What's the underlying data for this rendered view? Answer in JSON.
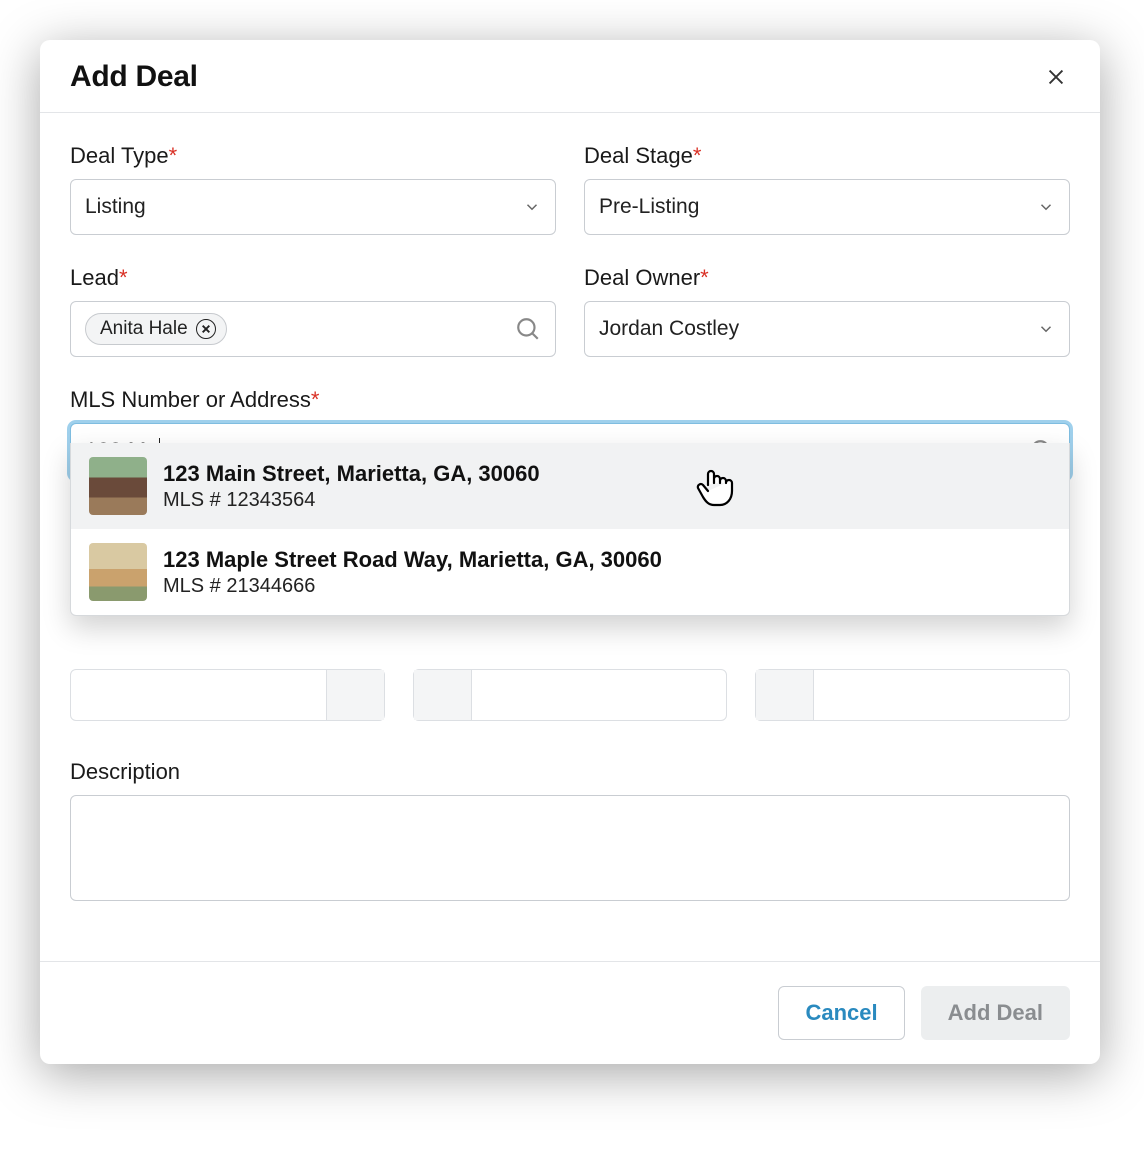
{
  "modal": {
    "title": "Add Deal"
  },
  "fields": {
    "dealType": {
      "label": "Deal Type",
      "value": "Listing"
    },
    "dealStage": {
      "label": "Deal Stage",
      "value": "Pre-Listing"
    },
    "lead": {
      "label": "Lead",
      "chip": "Anita Hale"
    },
    "dealOwner": {
      "label": "Deal Owner",
      "value": "Jordan Costley"
    },
    "mls": {
      "label": "MLS Number or Address",
      "value": "123 Ma"
    },
    "description": {
      "label": "Description",
      "value": ""
    }
  },
  "suggestions": [
    {
      "address": "123 Main Street, Marietta, GA, 30060",
      "mls": "MLS # 12343564"
    },
    {
      "address": "123 Maple Street Road Way, Marietta, GA, 30060",
      "mls": "MLS # 21344666"
    }
  ],
  "footer": {
    "cancel": "Cancel",
    "submit": "Add Deal"
  }
}
